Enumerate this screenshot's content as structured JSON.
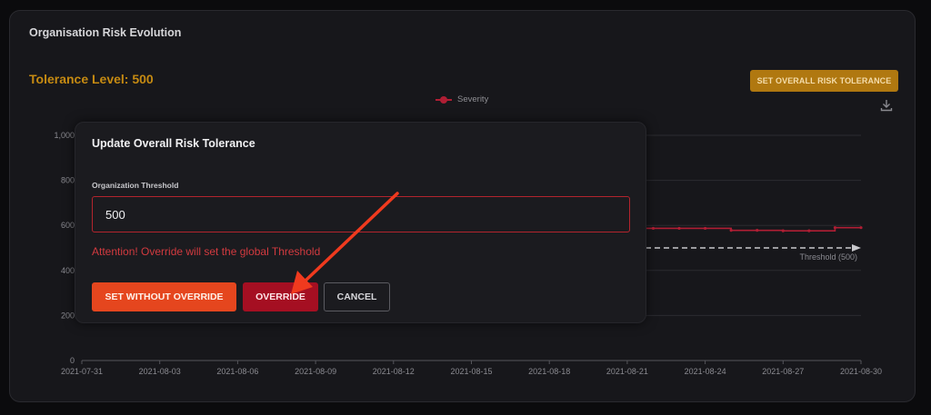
{
  "card": {
    "title": "Organisation Risk Evolution",
    "tolerance_label": "Tolerance Level: 500",
    "set_tolerance_button": "SET OVERALL RISK TOLERANCE",
    "download_icon": "download-icon"
  },
  "chart_data": {
    "type": "line",
    "title": "",
    "xlabel": "",
    "ylabel": "",
    "ylim": [
      0,
      1000
    ],
    "y_ticks": [
      "0",
      "200",
      "400",
      "600",
      "800",
      "1,000"
    ],
    "x_ticks": [
      "2021-07-31",
      "2021-08-03",
      "2021-08-06",
      "2021-08-09",
      "2021-08-12",
      "2021-08-15",
      "2021-08-18",
      "2021-08-21",
      "2021-08-24",
      "2021-08-27",
      "2021-08-30"
    ],
    "legend": {
      "position": "top-center",
      "entries": [
        "Severity"
      ]
    },
    "grid": true,
    "series": [
      {
        "name": "Severity",
        "color": "#b01e34",
        "x": [
          "2021-08-20",
          "2021-08-21",
          "2021-08-22",
          "2021-08-23",
          "2021-08-24",
          "2021-08-25",
          "2021-08-26",
          "2021-08-27",
          "2021-08-28",
          "2021-08-29",
          "2021-08-30"
        ],
        "values": [
          587,
          587,
          587,
          587,
          587,
          578,
          578,
          576,
          576,
          590,
          590
        ]
      }
    ],
    "threshold": {
      "label": "Threshold (500)",
      "value": 500
    }
  },
  "modal": {
    "title": "Update Overall Risk Tolerance",
    "field_label": "Organization Threshold",
    "field_value": "500",
    "warning": "Attention! Override will set the global Threshold",
    "set_without_override": "SET WITHOUT OVERRIDE",
    "override": "OVERRIDE",
    "cancel": "CANCEL"
  },
  "colors": {
    "accent": "#c58a12",
    "danger": "#a50f22",
    "orange": "#e5461e",
    "annotation_arrow": "#f03a1e"
  }
}
